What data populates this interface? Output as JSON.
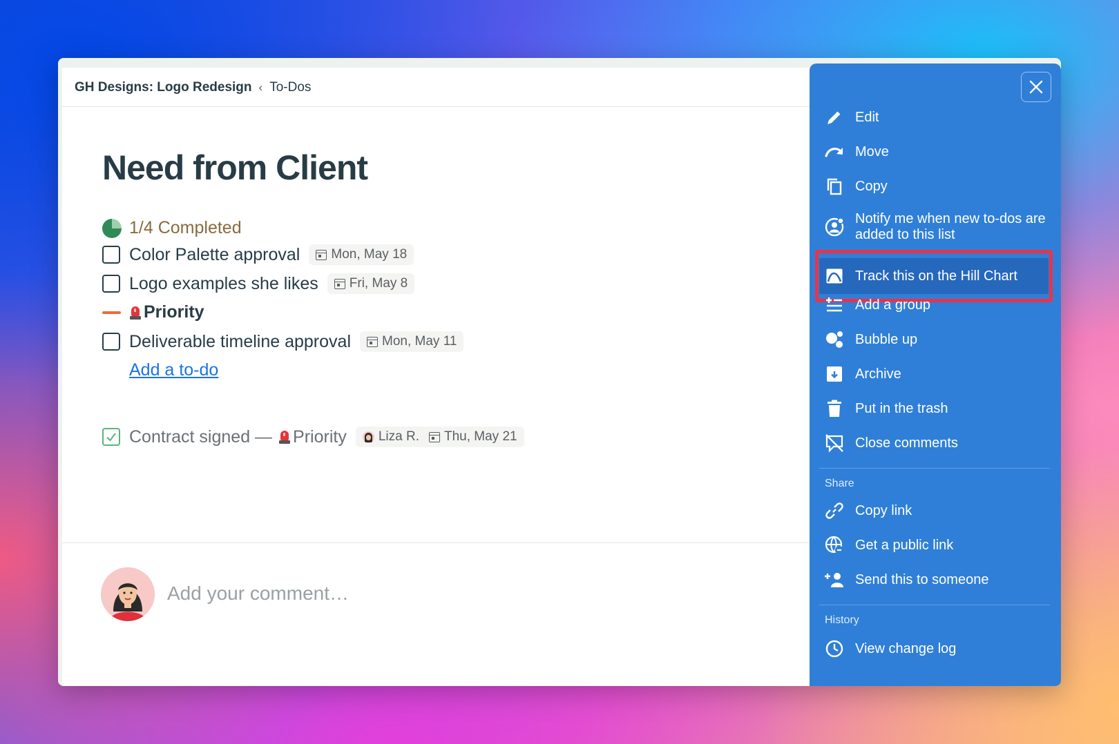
{
  "breadcrumb": {
    "project": "GH Designs: Logo Redesign",
    "separator": "‹",
    "section": "To-Dos"
  },
  "list": {
    "title": "Need from Client",
    "progress": {
      "label": "1/4 Completed",
      "completed": 1,
      "total": 4
    },
    "todos": [
      {
        "label": "Color Palette approval",
        "date": "Mon, May 18"
      },
      {
        "label": "Logo examples she likes",
        "date": "Fri, May 8"
      }
    ],
    "group": {
      "label": "Priority",
      "emoji": "siren",
      "todos": [
        {
          "label": "Deliverable timeline approval",
          "date": "Mon, May 11"
        }
      ]
    },
    "add_todo": "Add a to-do",
    "completed": {
      "label": "Contract signed —",
      "group": "Priority",
      "assignee": "Liza R.",
      "date": "Thu, May 21"
    }
  },
  "comment": {
    "placeholder": "Add your comment…"
  },
  "menu": {
    "items": [
      {
        "label": "Edit",
        "icon": "pencil-icon"
      },
      {
        "label": "Move",
        "icon": "move-arrow-icon"
      },
      {
        "label": "Copy",
        "icon": "copy-icon"
      },
      {
        "label": "Notify me when new to-dos are added to this list",
        "icon": "notify-person-icon"
      },
      {
        "label": "Track this on the Hill Chart",
        "icon": "hill-chart-icon",
        "highlighted": true
      },
      {
        "label": "Add a group",
        "icon": "add-group-icon"
      },
      {
        "label": "Bubble up",
        "icon": "bubble-up-icon"
      },
      {
        "label": "Archive",
        "icon": "archive-icon"
      },
      {
        "label": "Put in the trash",
        "icon": "trash-icon"
      },
      {
        "label": "Close comments",
        "icon": "close-comments-icon"
      }
    ],
    "share_heading": "Share",
    "share_items": [
      {
        "label": "Copy link",
        "icon": "link-icon"
      },
      {
        "label": "Get a public link",
        "icon": "globe-link-icon"
      },
      {
        "label": "Send this to someone",
        "icon": "add-person-icon"
      }
    ],
    "history_heading": "History",
    "history_items": [
      {
        "label": "View change log",
        "icon": "clock-icon"
      }
    ]
  },
  "colors": {
    "menu_bg": "#2f7fd8",
    "highlight_border": "#e8344a",
    "link": "#1a73e8",
    "progress_text": "#8a6a3e",
    "group_dash": "#ef6b3c"
  }
}
